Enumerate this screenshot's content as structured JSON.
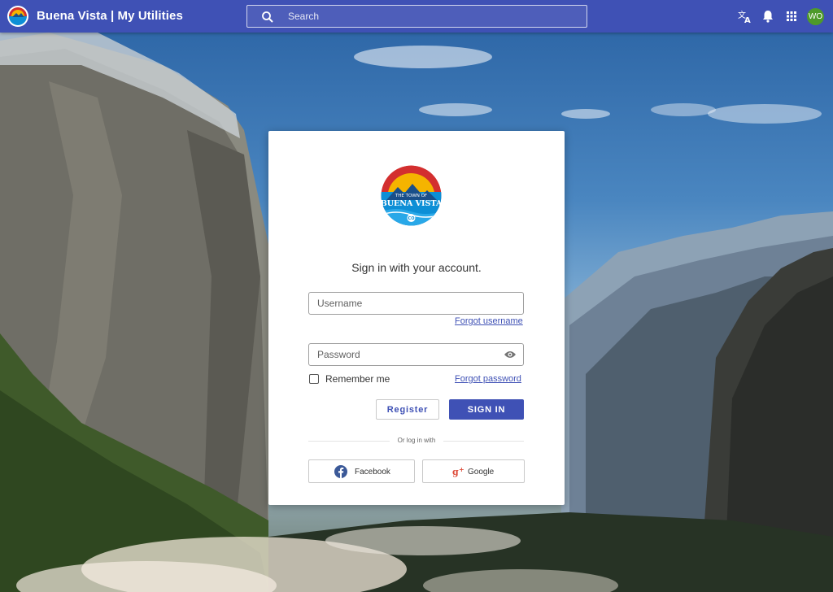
{
  "app": {
    "title": "Buena Vista | My Utilities",
    "logo_name": "buena-vista-logo"
  },
  "search": {
    "placeholder": "Search",
    "icon": "search-icon"
  },
  "header_icons": [
    "translate-icon",
    "bell-icon",
    "apps-grid-icon"
  ],
  "user": {
    "initials": "WO",
    "avatar_color": "#4e9a2a"
  },
  "login": {
    "heading": "Sign in with your account.",
    "logo_text_top": "THE TOWN OF",
    "logo_text_main": "BUENA VISTA",
    "logo_text_bottom": "CO",
    "username_placeholder": "Username",
    "forgot_username": "Forgot username",
    "password_placeholder": "Password",
    "remember_me": "Remember me",
    "forgot_password": "Forgot password",
    "register_label": "Register",
    "signin_label": "SIGN IN",
    "divider_text": "Or log in with",
    "facebook_label": "Facebook",
    "google_label": "Google"
  },
  "colors": {
    "primary": "#3f51b5",
    "facebook": "#3b5998",
    "google": "#dd4b39"
  }
}
